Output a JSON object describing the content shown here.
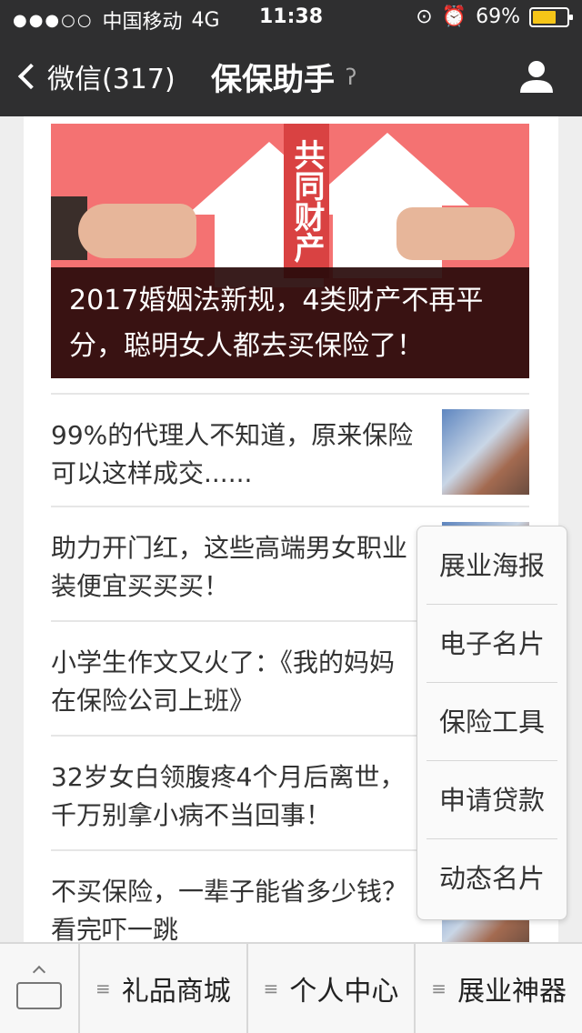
{
  "status_bar": {
    "signal": "●●●○○",
    "carrier": "中国移动",
    "network": "4G",
    "time": "11:38",
    "battery": "69%",
    "battery_level": 0.69
  },
  "nav": {
    "back_label": "微信(317)",
    "title": "保保助手"
  },
  "hero": {
    "sign_text": "共同财产",
    "caption": "2017婚姻法新规，4类财产不再平分，聪明女人都去买保险了！"
  },
  "news": [
    {
      "title": "99%的代理人不知道，原来保险可以这样成交......"
    },
    {
      "title": "助力开门红，这些高端男女职业装便宜买买买！"
    },
    {
      "title": "小学生作文又火了：《我的妈妈在保险公司上班》"
    },
    {
      "title": "32岁女白领腹疼4个月后离世，千万别拿小病不当回事！"
    },
    {
      "title": "不买保险，一辈子能省多少钱？看完吓一跳"
    }
  ],
  "popup_menu": [
    {
      "label": "展业海报"
    },
    {
      "label": "电子名片"
    },
    {
      "label": "保险工具"
    },
    {
      "label": "申请贷款"
    },
    {
      "label": "动态名片"
    }
  ],
  "tabbar": {
    "tabs": [
      {
        "label": "礼品商城"
      },
      {
        "label": "个人中心"
      },
      {
        "label": "展业神器"
      }
    ]
  }
}
